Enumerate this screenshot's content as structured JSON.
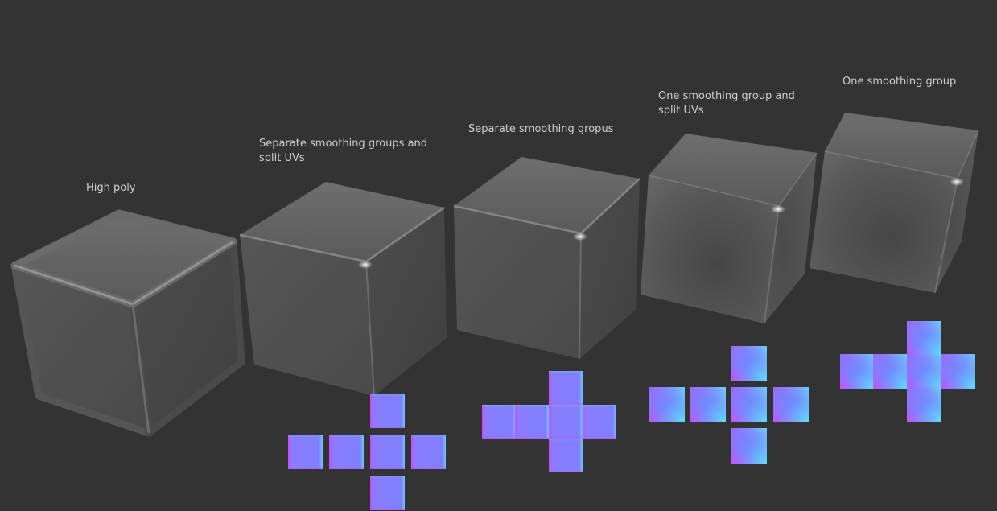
{
  "scene": {
    "background": "#333333",
    "variants": [
      {
        "label": "High poly",
        "edge_style": "rounded",
        "uv_layout": "none"
      },
      {
        "label": "Separate smoothing groups and split UVs",
        "edge_style": "hard-edges",
        "uv_layout": "cross-split",
        "uv_shading": "flat"
      },
      {
        "label": "Separate smoothing gropus",
        "edge_style": "hard-edges",
        "uv_layout": "cross-joined",
        "uv_shading": "flat"
      },
      {
        "label": "One smoothing group and split UVs",
        "edge_style": "soft-shaded",
        "uv_layout": "cross-split",
        "uv_shading": "gradient"
      },
      {
        "label": "One smoothing group",
        "edge_style": "soft-shaded",
        "uv_layout": "cross-joined",
        "uv_shading": "gradient"
      }
    ],
    "colors": {
      "normal_flat": "#8080ff",
      "normal_edge_magenta": "#d040ff",
      "normal_edge_cyan": "#60d8ff"
    }
  }
}
